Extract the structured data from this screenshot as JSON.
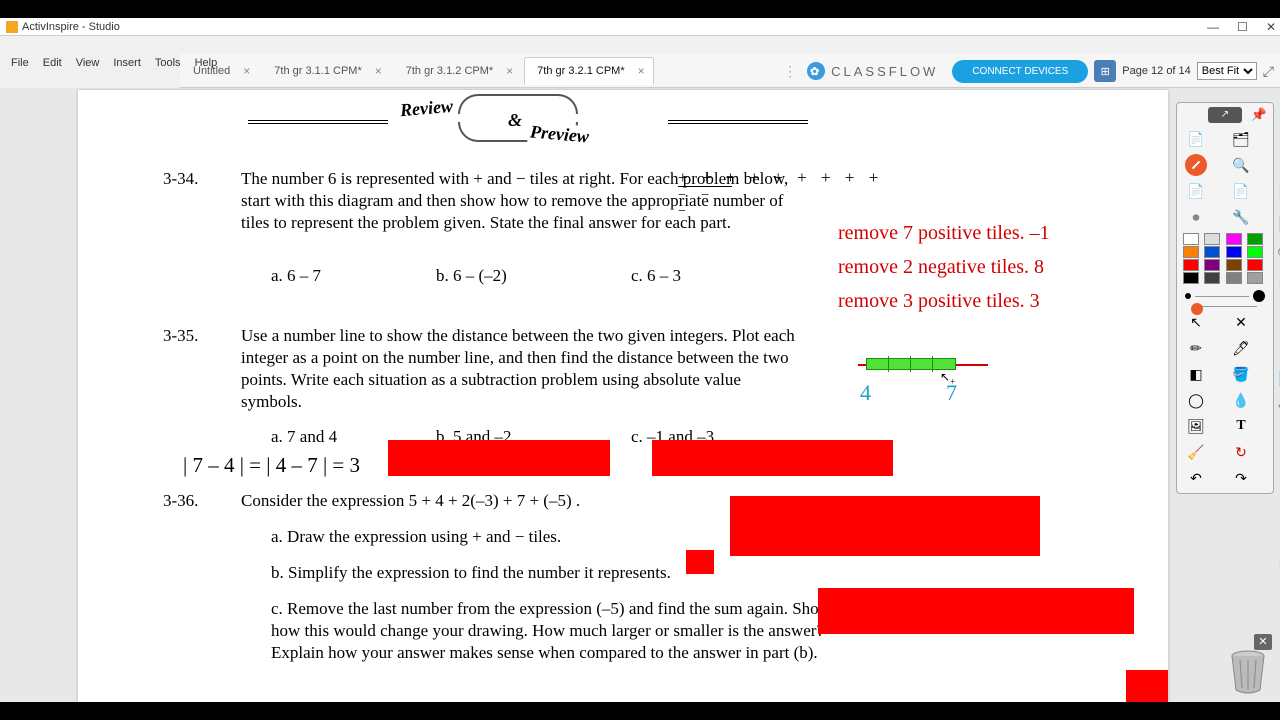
{
  "titlebar": {
    "title": "ActivInspire - Studio"
  },
  "menu": {
    "file": "File",
    "edit": "Edit",
    "view": "View",
    "insert": "Insert",
    "tools": "Tools",
    "help": "Help"
  },
  "tabs": [
    {
      "label": "Untitled",
      "active": false
    },
    {
      "label": "7th gr 3.1.1 CPM*",
      "active": false
    },
    {
      "label": "7th gr 3.1.2 CPM*",
      "active": false
    },
    {
      "label": "7th gr 3.2.1 CPM*",
      "active": true
    }
  ],
  "header": {
    "classflow": "CLASSFLOW",
    "connect": "CONNECT DEVICES",
    "page_indicator": "Page 12 of 14",
    "zoom": "Best Fit"
  },
  "review": {
    "review": "Review",
    "amp": "&",
    "preview": "Preview"
  },
  "q34": {
    "num": "3-34.",
    "text": "The number 6 is represented with  +  and  −  tiles at right.  For each problem below, start with this diagram and then show how to remove the appropriate number of tiles to represent the problem given.  State the final answer for each part.",
    "tiles_plus": "+ + + + + + + + +",
    "tiles_minus": "− − −",
    "a": "a.    6 – 7",
    "b": "b.    6 – (–2)",
    "c": "c.    6 – 3"
  },
  "redtext": {
    "l1": "remove 7 positive tiles. –1",
    "l2": "remove 2 negative tiles. 8",
    "l3": "remove 3 positive tiles. 3"
  },
  "q35": {
    "num": "3-35.",
    "text": "Use a number line to show the distance between the two given integers.  Plot each integer as a point on the number line, and then find the distance between the two points.  Write each situation as a subtraction problem using absolute value symbols.",
    "a": "a.    7 and 4",
    "b": "b.    5 and –2",
    "c": "c.    –1 and –3"
  },
  "answer35a": "| 7 – 4 | = | 4 – 7 | = 3",
  "numline": {
    "left": "4",
    "right": "7"
  },
  "q36": {
    "num": "3-36.",
    "text": "Consider the expression  5 + 4 + 2(–3) + 7 + (–5) .",
    "a": "a.    Draw the expression using  +  and  −  tiles.",
    "b": "b.    Simplify the expression to find the number it represents.",
    "c": "c.    Remove the last number from the expression (–5) and find the sum again.  Show how this would change your drawing.  How much larger or smaller is the answer?  Explain how your answer makes sense when compared to the answer in part (b)."
  },
  "palette": [
    "#ffffff",
    "#dddddd",
    "#ff00ff",
    "#00a000",
    "#ff8000",
    "#0050d0",
    "#0000ff",
    "#00ff00",
    "#ff0000",
    "#800080",
    "#804000",
    "#ff0000",
    "#000000",
    "#404040",
    "#808080",
    "#a0a0a0"
  ],
  "side_icons": [
    "📋",
    "📄",
    "🔍",
    "📋",
    "⊞",
    "⊞",
    "📄",
    "🔧",
    "A",
    "T",
    "⊡",
    "↺",
    "📋"
  ]
}
